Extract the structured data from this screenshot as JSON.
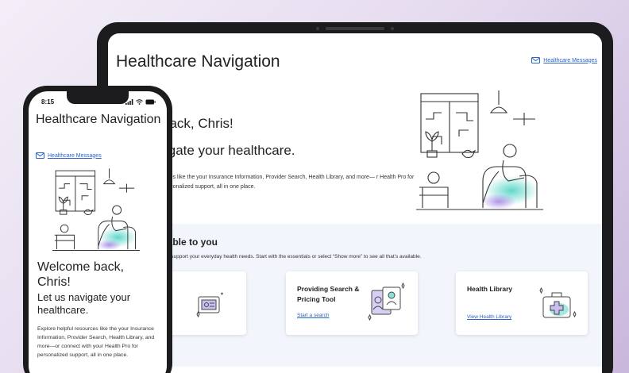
{
  "tablet": {
    "page_title": "Healthcare Navigation",
    "messages_link": "Healthcare Messages",
    "welcome": "back, Chris!",
    "subtitle": "igate your healthcare.",
    "description": "urces like the your Insurance Information, Provider Search, Health Library, and more— r Health Pro for personalized support, all in one place.",
    "section": {
      "title": "ilable to you",
      "description": "to support your everyday health needs. Start with the essentials or select “Show more” to see all that’s available.",
      "cards": [
        {
          "title": "",
          "link": ""
        },
        {
          "title": "Providing Search & Pricing Tool",
          "link": "Start a search"
        },
        {
          "title": "Health Library",
          "link": "View Health Library"
        }
      ]
    }
  },
  "phone": {
    "time": "8:15",
    "page_title": "Healthcare Navigation",
    "messages_link": "Healthcare Messages",
    "welcome": "Welcome back, Chris!",
    "subtitle": "Let us navigate your healthcare.",
    "description": "Explore helpful resources like the your Insurance Information, Provider Search, Health Library, and more—or connect with your Health Pro for personalized support, all in one place."
  },
  "colors": {
    "link": "#2b63c6",
    "accent_teal": "#5ad6c8",
    "accent_purple": "#a68ae6",
    "section_bg": "#f2f5fb"
  },
  "icons": [
    "mail-icon",
    "signal-icon",
    "wifi-icon",
    "battery-icon",
    "document-icon",
    "doctor-profile-icon",
    "first-aid-kit-icon",
    "sparkle-icon"
  ]
}
